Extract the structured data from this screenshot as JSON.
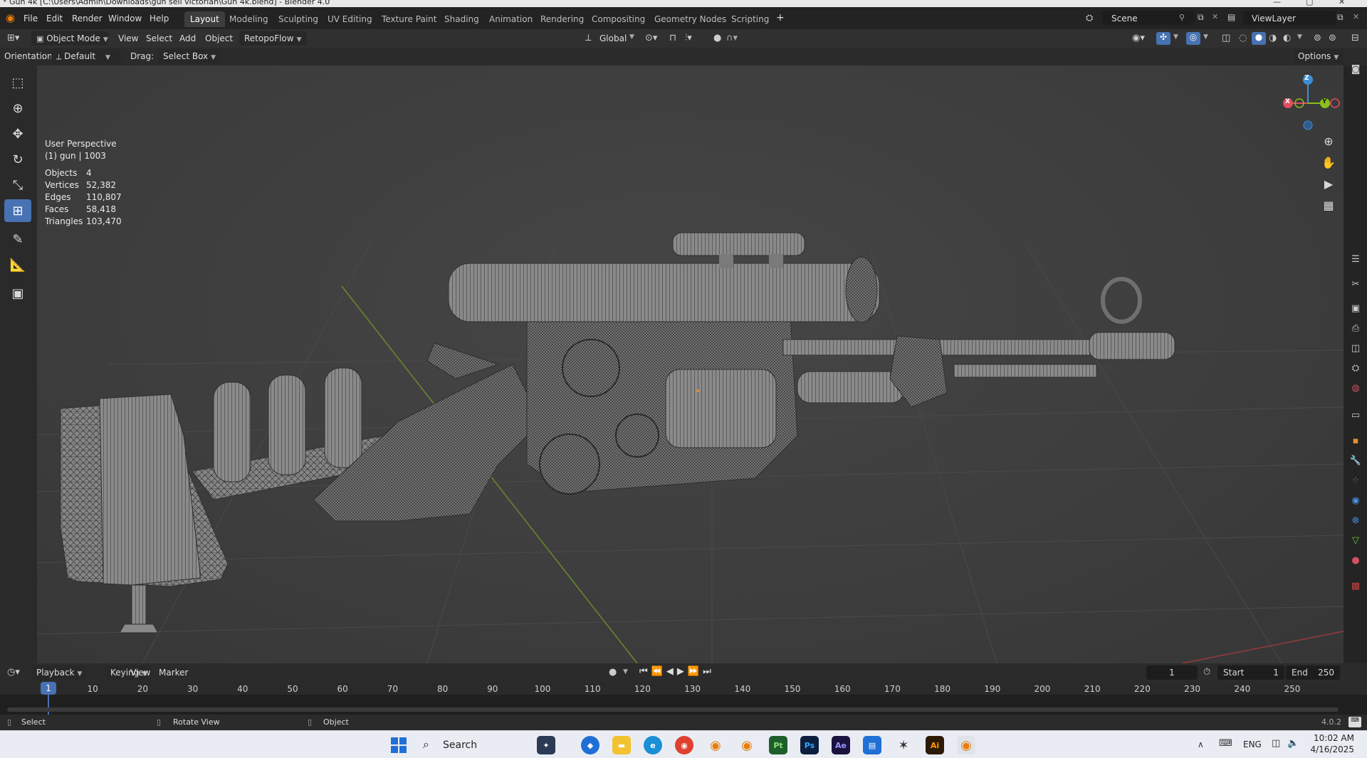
{
  "window": {
    "title": "* Gun 4k [C:\\Users\\Admin\\Downloads\\gun sell victorian\\Gun 4k.blend] - Blender 4.0"
  },
  "menubar": {
    "items": [
      "File",
      "Edit",
      "Render",
      "Window",
      "Help"
    ],
    "workspaces": [
      "Layout",
      "Modeling",
      "Sculpting",
      "UV Editing",
      "Texture Paint",
      "Shading",
      "Animation",
      "Rendering",
      "Compositing",
      "Geometry Nodes",
      "Scripting"
    ],
    "active_workspace": "Layout",
    "add_tab": "+",
    "scene_label": "Scene",
    "viewlayer_label": "ViewLayer"
  },
  "header": {
    "mode": "Object Mode",
    "menus": [
      "View",
      "Select",
      "Add",
      "Object",
      "RetopoFlow"
    ],
    "transform_orientation": "Global"
  },
  "toolsettings": {
    "orientation_label": "Orientation:",
    "orientation_value": "Default",
    "drag_label": "Drag:",
    "drag_value": "Select Box",
    "options_label": "Options"
  },
  "viewport": {
    "view_name": "User Perspective",
    "collection_info": "(1) gun | 1003",
    "stats": [
      {
        "label": "Objects",
        "value": "4"
      },
      {
        "label": "Vertices",
        "value": "52,382"
      },
      {
        "label": "Edges",
        "value": "110,807"
      },
      {
        "label": "Faces",
        "value": "58,418"
      },
      {
        "label": "Triangles",
        "value": "103,470"
      }
    ],
    "gizmo_axes": {
      "x": "X",
      "y": "Y",
      "z": "Z"
    },
    "axis_colors": {
      "x": "#e04d5f",
      "y": "#8bbe1d",
      "z": "#3e8fd8"
    }
  },
  "timeline": {
    "menus": [
      "Playback",
      "Keying",
      "View",
      "Marker"
    ],
    "current_frame": "1",
    "start_label": "Start",
    "start_value": "1",
    "end_label": "End",
    "end_value": "250",
    "frame_marks": [
      "1",
      "10",
      "20",
      "30",
      "40",
      "50",
      "60",
      "70",
      "80",
      "90",
      "100",
      "110",
      "120",
      "130",
      "140",
      "150",
      "160",
      "170",
      "180",
      "190",
      "200",
      "210",
      "220",
      "230",
      "240",
      "250"
    ]
  },
  "statusbar": {
    "select": "Select",
    "rotate": "Rotate View",
    "object": "Object",
    "version": "4.0.2"
  },
  "taskbar": {
    "search_label": "Search",
    "language": "ENG",
    "time": "10:02 AM",
    "date": "4/16/2025",
    "apps": [
      {
        "name": "Pt",
        "color": "#1e5e2a",
        "fg": "#8fe07a"
      },
      {
        "name": "Ps",
        "color": "#0b1e3d",
        "fg": "#31a8ff"
      },
      {
        "name": "Ae",
        "color": "#1b1240",
        "fg": "#9999ff"
      },
      {
        "name": "Ai",
        "color": "#2c1a06",
        "fg": "#ff9a00"
      }
    ]
  },
  "colors": {
    "accent": "#4772b3",
    "active_tool": "#4772b3",
    "playhead": "#4772b3"
  }
}
